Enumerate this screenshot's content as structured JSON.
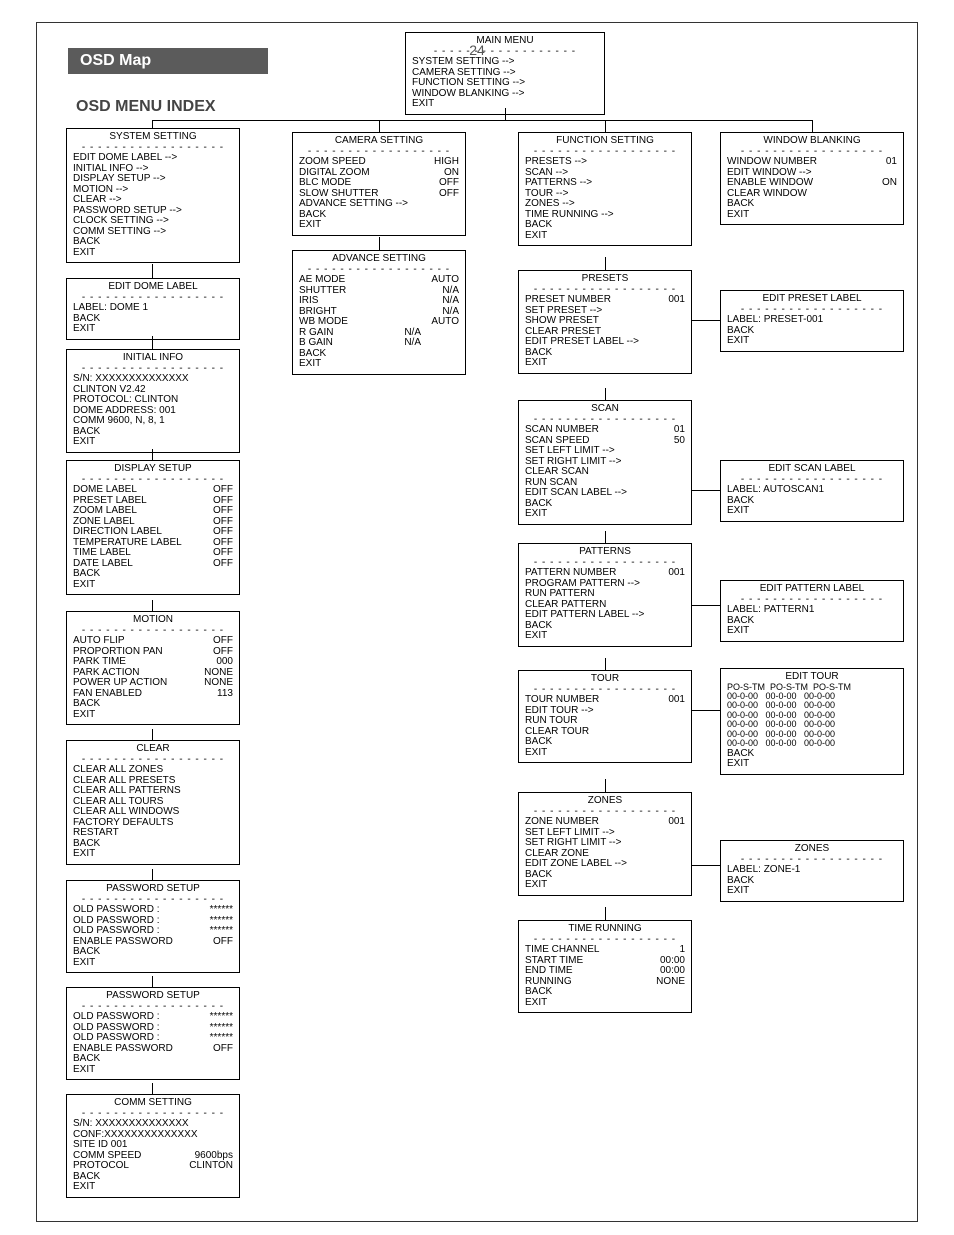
{
  "header": {
    "tab": "OSD Map",
    "heading": "OSD MENU INDEX",
    "pageNumber": "24"
  },
  "mainMenu": {
    "title": "MAIN MENU",
    "items": [
      "SYSTEM SETTING -->",
      "CAMERA SETTING -->",
      "FUNCTION SETTING -->",
      "WINDOW BLANKING -->",
      "EXIT"
    ]
  },
  "systemSetting": {
    "title": "SYSTEM SETTING",
    "items": [
      "EDIT DOME LABEL -->",
      "INITIAL INFO -->",
      "DISPLAY SETUP -->",
      "MOTION -->",
      "CLEAR -->",
      "PASSWORD SETUP -->",
      "CLOCK SETTING -->",
      "COMM SETTING -->",
      "BACK",
      "EXIT"
    ]
  },
  "editDomeLabel": {
    "title": "EDIT DOME LABEL",
    "items": [
      "LABEL: DOME 1",
      "BACK",
      "EXIT"
    ]
  },
  "initialInfo": {
    "title": "INITIAL INFO",
    "items": [
      "S/N: XXXXXXXXXXXXXX",
      "CLINTON V2.42",
      "PROTOCOL: CLINTON",
      "DOME ADDRESS: 001",
      " COMM  9600, N, 8, 1",
      "BACK",
      "EXIT"
    ]
  },
  "displaySetup": {
    "title": "DISPLAY SETUP",
    "rows": [
      [
        "DOME LABEL",
        "OFF"
      ],
      [
        "PRESET LABEL",
        "OFF"
      ],
      [
        "ZOOM LABEL",
        "OFF"
      ],
      [
        "ZONE LABEL",
        "OFF"
      ],
      [
        "DIRECTION LABEL",
        "OFF"
      ],
      [
        "TEMPERATURE LABEL",
        "OFF"
      ],
      [
        "TIME LABEL",
        "OFF"
      ],
      [
        "DATE LABEL",
        "OFF"
      ]
    ],
    "tail": [
      "BACK",
      "EXIT"
    ]
  },
  "motion": {
    "title": "MOTION",
    "rows": [
      [
        "AUTO FLIP",
        "OFF"
      ],
      [
        "PROPORTION PAN",
        "OFF"
      ],
      [
        "PARK TIME",
        "000"
      ],
      [
        " PARK ACTION",
        "NONE"
      ],
      [
        "POWER UP ACTION",
        "NONE"
      ],
      [
        "FAN ENABLED",
        "113"
      ]
    ],
    "tail": [
      "BACK",
      "EXIT"
    ]
  },
  "clear": {
    "title": "CLEAR",
    "items": [
      "CLEAR ALL ZONES",
      "CLEAR ALL PRESETS",
      "CLEAR ALL PATTERNS",
      "CLEAR ALL TOURS",
      "CLEAR ALL WINDOWS",
      "FACTORY DEFAULTS",
      "RESTART",
      "BACK",
      "EXIT"
    ]
  },
  "passwordSetup1": {
    "title": "PASSWORD SETUP",
    "rows": [
      [
        "OLD PASSWORD  :",
        "******"
      ],
      [
        "OLD PASSWORD  :",
        "******"
      ],
      [
        "OLD PASSWORD  :",
        "******"
      ],
      [
        "ENABLE PASSWORD",
        "OFF"
      ]
    ],
    "tail": [
      "BACK",
      "EXIT"
    ]
  },
  "passwordSetup2": {
    "title": "PASSWORD SETUP",
    "rows": [
      [
        "OLD PASSWORD  :",
        "******"
      ],
      [
        "OLD PASSWORD  :",
        "******"
      ],
      [
        "OLD PASSWORD  :",
        "******"
      ],
      [
        "ENABLE PASSWORD",
        "OFF"
      ]
    ],
    "tail": [
      "BACK",
      "EXIT"
    ]
  },
  "commSetting": {
    "title": "COMM SETTING",
    "items": [
      "S/N: XXXXXXXXXXXXXX",
      "CONF:XXXXXXXXXXXXXX",
      "SITE ID  001"
    ],
    "rows": [
      [
        "COMM  SPEED",
        "9600bps"
      ],
      [
        "PROTOCOL",
        "CLINTON"
      ]
    ],
    "tail": [
      "BACK",
      "EXIT"
    ]
  },
  "cameraSetting": {
    "title": "CAMERA SETTING",
    "rows": [
      [
        "ZOOM SPEED",
        "HIGH"
      ],
      [
        "DIGITAL ZOOM",
        "ON"
      ],
      [
        "BLC MODE",
        "OFF"
      ],
      [
        "SLOW SHUTTER",
        "OFF"
      ]
    ],
    "items": [
      "ADVANCE SETTING  -->",
      "BACK",
      "EXIT"
    ]
  },
  "advanceSetting": {
    "title": "ADVANCE SETTING",
    "rows": [
      [
        "AE MODE",
        "AUTO"
      ],
      [
        " SHUTTER",
        "N/A"
      ],
      [
        " IRIS",
        "N/A"
      ],
      [
        " BRIGHT",
        "N/A"
      ],
      [
        "WB MODE",
        "AUTO"
      ]
    ],
    "innerRows": [
      [
        " R GAIN",
        "N/A"
      ],
      [
        " B GAIN",
        "N/A"
      ]
    ],
    "tail": [
      "BACK",
      "EXIT"
    ]
  },
  "functionSetting": {
    "title": "FUNCTION SETTING",
    "items": [
      "PRESETS  -->",
      "SCAN  -->",
      "PATTERNS  -->",
      "TOUR  -->",
      "ZONES  -->",
      "TIME RUNNING  -->",
      "BACK",
      "EXIT"
    ]
  },
  "presets": {
    "title": "PRESETS",
    "rows": [
      [
        "PRESET NUMBER",
        "001"
      ]
    ],
    "items": [
      "SET PRESET -->",
      "SHOW PRESET",
      "CLEAR PRESET",
      "EDIT PRESET LABEL  -->",
      "BACK",
      "EXIT"
    ]
  },
  "editPresetLabel": {
    "title": "EDIT PRESET LABEL",
    "items": [
      "LABEL: PRESET-001",
      "BACK",
      "EXIT"
    ]
  },
  "scan": {
    "title": "SCAN",
    "rows": [
      [
        "SCAN NUMBER",
        "01"
      ],
      [
        "SCAN SPEED",
        "50"
      ]
    ],
    "items": [
      "SET LEFT LIMIT  -->",
      "SET RIGHT LIMIT  -->",
      "CLEAR SCAN",
      "RUN SCAN",
      "EDIT SCAN LABEL  -->",
      "BACK",
      "EXIT"
    ]
  },
  "editScanLabel": {
    "title": "EDIT SCAN LABEL",
    "items": [
      "LABEL: AUTOSCAN1",
      "BACK",
      "EXIT"
    ]
  },
  "patterns": {
    "title": "PATTERNS",
    "rows": [
      [
        "PATTERN NUMBER",
        "001"
      ]
    ],
    "items": [
      "PROGRAM PATTERN -->",
      "RUN PATTERN",
      "CLEAR PATTERN",
      "EDIT PATTERN LABEL  -->",
      "BACK",
      "EXIT"
    ]
  },
  "editPatternLabel": {
    "title": "EDIT PATTERN LABEL",
    "items": [
      "LABEL: PATTERN1",
      "BACK",
      "EXIT"
    ]
  },
  "tour": {
    "title": "TOUR",
    "rows": [
      [
        "TOUR NUMBER",
        "001"
      ]
    ],
    "items": [
      "EDIT TOUR  -->",
      "RUN TOUR",
      "CLEAR TOUR",
      "BACK",
      "EXIT"
    ]
  },
  "editTour": {
    "title": "EDIT TOUR",
    "header": "PO-S-TM  PO-S-TM  PO-S-TM",
    "dataRows": [
      "00-0-00   00-0-00   00-0-00",
      "00-0-00   00-0-00   00-0-00",
      "00-0-00   00-0-00   00-0-00",
      "00-0-00   00-0-00   00-0-00",
      "00-0-00   00-0-00   00-0-00",
      "00-0-00   00-0-00   00-0-00"
    ],
    "tail": [
      "BACK",
      "EXIT"
    ]
  },
  "zones": {
    "title": "ZONES",
    "rows": [
      [
        "ZONE NUMBER",
        "001"
      ]
    ],
    "items": [
      "SET LEFT LIMIT -->",
      "SET RIGHT LIMIT -->",
      "CLEAR ZONE",
      "EDIT ZONE LABEL  -->",
      "BACK",
      "EXIT"
    ]
  },
  "editZoneLabel": {
    "title": "ZONES",
    "items": [
      "LABEL: ZONE-1",
      "BACK",
      "EXIT"
    ]
  },
  "timeRunning": {
    "title": "TIME RUNNING",
    "rows": [
      [
        "TIME CHANNEL",
        "1"
      ],
      [
        "START TIME",
        "00:00"
      ],
      [
        "END TIME",
        "00:00"
      ],
      [
        "RUNNING",
        "NONE"
      ]
    ],
    "tail": [
      "BACK",
      "EXIT"
    ]
  },
  "windowBlanking": {
    "title": "WINDOW BLANKING",
    "rows": [
      [
        "WINDOW NUMBER",
        "01"
      ]
    ],
    "items2": [
      "EDIT WINDOW -->"
    ],
    "rows2": [
      [
        "ENABLE WINDOW",
        "ON"
      ]
    ],
    "items": [
      "CLEAR WINDOW",
      "BACK",
      "EXIT"
    ]
  }
}
